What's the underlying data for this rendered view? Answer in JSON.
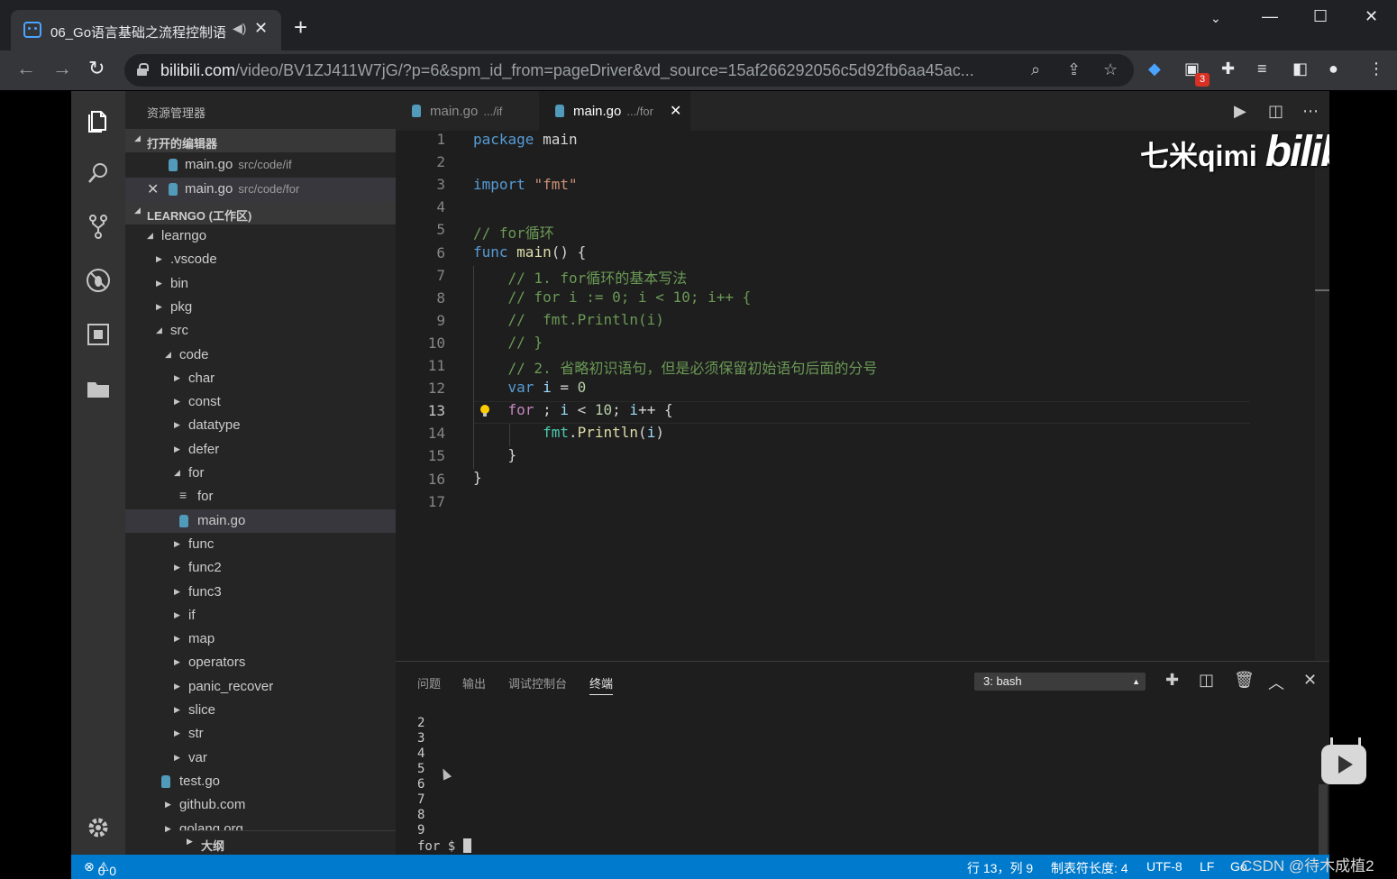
{
  "browser": {
    "tab_title": "06_Go语言基础之流程控制语",
    "url_domain": "bilibili.com",
    "url_rest": "/video/BV1ZJ411W7jG/?p=6&spm_id_from=pageDriver&vd_source=15af266292056c5d92fb6aa45ac...",
    "extension_badge": "3"
  },
  "vscode": {
    "explorer_title": "资源管理器",
    "open_editors_header": "打开的编辑器",
    "open_editors": [
      {
        "name": "main.go",
        "path": "src/code/if"
      },
      {
        "name": "main.go",
        "path": "src/code/for"
      }
    ],
    "workspace_header": "LEARNGO (工作区)",
    "tree": [
      {
        "label": "learngo",
        "arrow": "▲"
      },
      {
        "label": ".vscode",
        "arrow": "▶"
      },
      {
        "label": "bin",
        "arrow": "▶"
      },
      {
        "label": "pkg",
        "arrow": "▶"
      },
      {
        "label": "src",
        "arrow": "▲"
      },
      {
        "label": "code",
        "arrow": "▲"
      },
      {
        "label": "char",
        "arrow": "▶"
      },
      {
        "label": "const",
        "arrow": "▶"
      },
      {
        "label": "datatype",
        "arrow": "▶"
      },
      {
        "label": "defer",
        "arrow": "▶"
      },
      {
        "label": "for",
        "arrow": "▲"
      },
      {
        "label": "for",
        "arrow": "≡"
      },
      {
        "label": "main.go",
        "arrow": ""
      },
      {
        "label": "func",
        "arrow": "▶"
      },
      {
        "label": "func2",
        "arrow": "▶"
      },
      {
        "label": "func3",
        "arrow": "▶"
      },
      {
        "label": "if",
        "arrow": "▶"
      },
      {
        "label": "map",
        "arrow": "▶"
      },
      {
        "label": "operators",
        "arrow": "▶"
      },
      {
        "label": "panic_recover",
        "arrow": "▶"
      },
      {
        "label": "slice",
        "arrow": "▶"
      },
      {
        "label": "str",
        "arrow": "▶"
      },
      {
        "label": "var",
        "arrow": "▶"
      },
      {
        "label": "test.go",
        "arrow": ""
      },
      {
        "label": "github.com",
        "arrow": "▶"
      },
      {
        "label": "golang.org",
        "arrow": "▶"
      }
    ],
    "outline_header": "大纲",
    "editor_tabs": [
      {
        "name": "main.go",
        "path": ".../if"
      },
      {
        "name": "main.go",
        "path": ".../for"
      }
    ],
    "line_numbers": [
      "1",
      "2",
      "3",
      "4",
      "5",
      "6",
      "7",
      "8",
      "9",
      "10",
      "11",
      "12",
      "13",
      "14",
      "15",
      "16",
      "17"
    ],
    "current_line": "13",
    "watermark_text": "七米qimi",
    "watermark_brand": "bilibili",
    "panel_tabs": [
      "问题",
      "输出",
      "调试控制台",
      "终端"
    ],
    "terminal_select": "3: bash",
    "terminal_lines": [
      "2",
      "3",
      "4",
      "5",
      "6",
      "7",
      "8",
      "9"
    ],
    "terminal_prompt": "for $ ",
    "status": {
      "errors": "0",
      "warnings": "0",
      "position": "行 13，列 9",
      "tab_size": "制表符长度: 4",
      "encoding": "UTF-8",
      "eol": "LF",
      "language": "Go"
    }
  },
  "overlay_text": "CSDN @待木成植2",
  "colors": {
    "statusbar": "#007acc",
    "keyword": "#569cd6",
    "comment": "#6a9955",
    "string": "#ce9178"
  }
}
